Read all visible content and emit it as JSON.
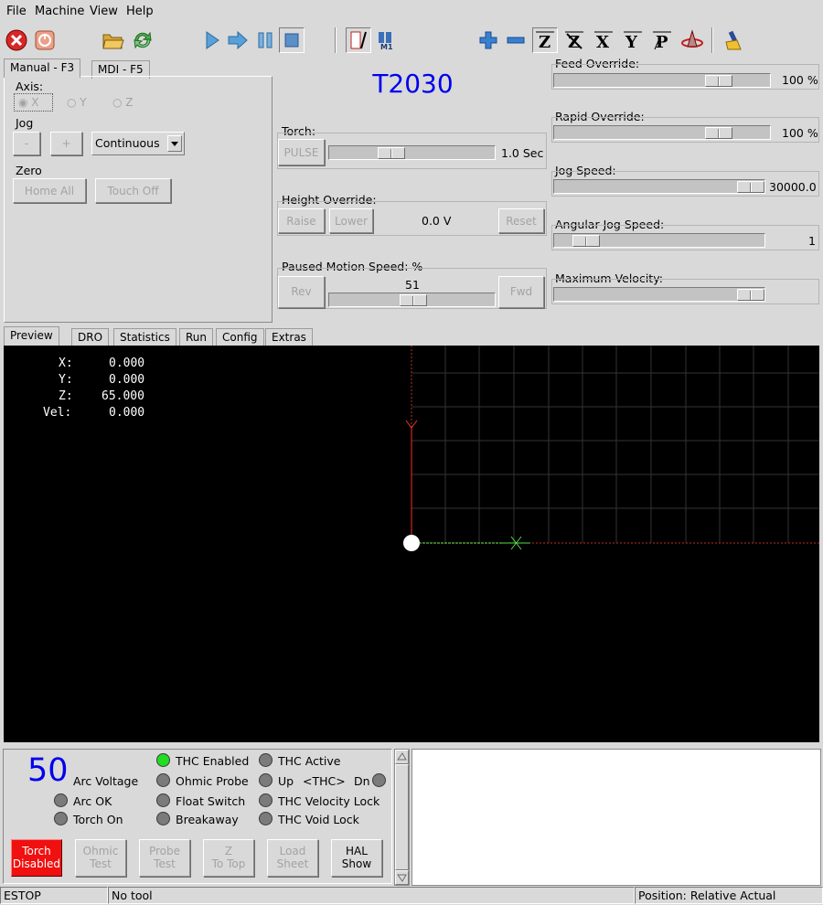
{
  "menu": {
    "file": "File",
    "machine": "Machine",
    "view": "View",
    "help": "Help"
  },
  "toolbar": {
    "icons": [
      "estop-icon",
      "power-icon",
      "open-file-icon",
      "reload-icon",
      "run-icon",
      "step-icon",
      "pause-icon",
      "stop-icon",
      "touch-off-icon",
      "mist-icon",
      "zoom-in-icon",
      "zoom-out-icon",
      "view-z-icon",
      "view-z2-icon",
      "view-x-icon",
      "view-y-icon",
      "view-p-icon",
      "rotate-icon",
      "clear-icon"
    ],
    "accent_red": "#d62828"
  },
  "left_tabs": {
    "manual": "Manual - F3",
    "mdi": "MDI - F5"
  },
  "manual": {
    "axis_label": "Axis:",
    "axes": [
      "X",
      "Y",
      "Z"
    ],
    "jog_label": "Jog",
    "jog_minus": "-",
    "jog_plus": "+",
    "jog_mode": "Continuous",
    "zero_label": "Zero",
    "home_all": "Home All",
    "touch_off": "Touch Off"
  },
  "center": {
    "title": "T2030",
    "title_color": "#0000ee",
    "torch_label": "Torch:",
    "pulse": "PULSE",
    "torch_time": "1.0 Sec",
    "torch_slider": 0.35,
    "height_label": "Height Override:",
    "raise": "Raise",
    "lower": "Lower",
    "height_value": "0.0 V",
    "reset": "Reset",
    "paused_label": "Paused Motion Speed: %",
    "paused_value": "51",
    "paused_slider": 0.51,
    "rev": "Rev",
    "fwd": "Fwd"
  },
  "right": {
    "feed_label": "Feed Override:",
    "feed_value": "100 %",
    "feed_slider": 0.8,
    "rapid_label": "Rapid Override:",
    "rapid_value": "100 %",
    "rapid_slider": 0.8,
    "jog_speed_label": "Jog Speed:",
    "jog_speed_value": "30000.0",
    "jog_speed_slider": 1.0,
    "ang_label": "Angular Jog Speed:",
    "ang_value": "1",
    "ang_slider": 0.1,
    "maxvel_label": "Maximum Velocity:",
    "maxvel_slider": 1.0
  },
  "lower_tabs": [
    "Preview",
    "DRO",
    "Statistics",
    "Run",
    "Config",
    "Extras"
  ],
  "dro": [
    {
      "axis": "X:",
      "value": "0.000"
    },
    {
      "axis": "Y:",
      "value": "0.000"
    },
    {
      "axis": "Z:",
      "value": "65.000"
    },
    {
      "axis": "Vel:",
      "value": "0.000"
    }
  ],
  "plasma": {
    "arc_value": "50",
    "arc_label": "Arc Voltage",
    "arc_ok": "Arc OK",
    "torch_on": "Torch On",
    "thc_enabled": "THC Enabled",
    "ohmic_probe": "Ohmic Probe",
    "float_switch": "Float Switch",
    "breakaway": "Breakaway",
    "thc_active": "THC Active",
    "up": "Up",
    "thc": "<THC>",
    "dn": "Dn",
    "thc_vel_lock": "THC Velocity Lock",
    "thc_void_lock": "THC Void Lock",
    "btn_torch": [
      "Torch",
      "Disabled"
    ],
    "btn_ohmic": [
      "Ohmic",
      "Test"
    ],
    "btn_probe": [
      "Probe",
      "Test"
    ],
    "btn_ztop": [
      "Z",
      "To Top"
    ],
    "btn_load": [
      "Load",
      "Sheet"
    ],
    "btn_hal": [
      "HAL",
      "Show"
    ]
  },
  "status": {
    "estop": "ESTOP",
    "tool": "No tool",
    "position": "Position: Relative Actual"
  }
}
